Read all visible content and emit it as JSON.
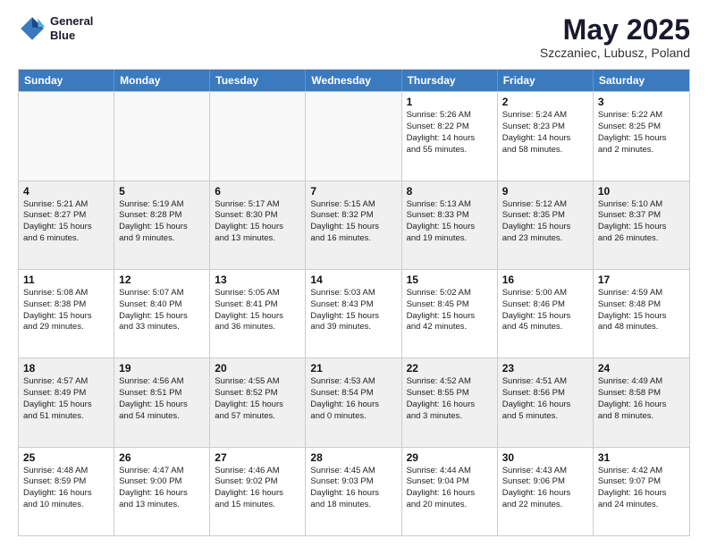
{
  "header": {
    "logo_line1": "General",
    "logo_line2": "Blue",
    "title": "May 2025",
    "subtitle": "Szczaniec, Lubusz, Poland"
  },
  "calendar": {
    "days_of_week": [
      "Sunday",
      "Monday",
      "Tuesday",
      "Wednesday",
      "Thursday",
      "Friday",
      "Saturday"
    ],
    "rows": [
      [
        {
          "day": "",
          "info": "",
          "empty": true
        },
        {
          "day": "",
          "info": "",
          "empty": true
        },
        {
          "day": "",
          "info": "",
          "empty": true
        },
        {
          "day": "",
          "info": "",
          "empty": true
        },
        {
          "day": "1",
          "info": "Sunrise: 5:26 AM\nSunset: 8:22 PM\nDaylight: 14 hours\nand 55 minutes."
        },
        {
          "day": "2",
          "info": "Sunrise: 5:24 AM\nSunset: 8:23 PM\nDaylight: 14 hours\nand 58 minutes."
        },
        {
          "day": "3",
          "info": "Sunrise: 5:22 AM\nSunset: 8:25 PM\nDaylight: 15 hours\nand 2 minutes."
        }
      ],
      [
        {
          "day": "4",
          "info": "Sunrise: 5:21 AM\nSunset: 8:27 PM\nDaylight: 15 hours\nand 6 minutes."
        },
        {
          "day": "5",
          "info": "Sunrise: 5:19 AM\nSunset: 8:28 PM\nDaylight: 15 hours\nand 9 minutes."
        },
        {
          "day": "6",
          "info": "Sunrise: 5:17 AM\nSunset: 8:30 PM\nDaylight: 15 hours\nand 13 minutes."
        },
        {
          "day": "7",
          "info": "Sunrise: 5:15 AM\nSunset: 8:32 PM\nDaylight: 15 hours\nand 16 minutes."
        },
        {
          "day": "8",
          "info": "Sunrise: 5:13 AM\nSunset: 8:33 PM\nDaylight: 15 hours\nand 19 minutes."
        },
        {
          "day": "9",
          "info": "Sunrise: 5:12 AM\nSunset: 8:35 PM\nDaylight: 15 hours\nand 23 minutes."
        },
        {
          "day": "10",
          "info": "Sunrise: 5:10 AM\nSunset: 8:37 PM\nDaylight: 15 hours\nand 26 minutes."
        }
      ],
      [
        {
          "day": "11",
          "info": "Sunrise: 5:08 AM\nSunset: 8:38 PM\nDaylight: 15 hours\nand 29 minutes."
        },
        {
          "day": "12",
          "info": "Sunrise: 5:07 AM\nSunset: 8:40 PM\nDaylight: 15 hours\nand 33 minutes."
        },
        {
          "day": "13",
          "info": "Sunrise: 5:05 AM\nSunset: 8:41 PM\nDaylight: 15 hours\nand 36 minutes."
        },
        {
          "day": "14",
          "info": "Sunrise: 5:03 AM\nSunset: 8:43 PM\nDaylight: 15 hours\nand 39 minutes."
        },
        {
          "day": "15",
          "info": "Sunrise: 5:02 AM\nSunset: 8:45 PM\nDaylight: 15 hours\nand 42 minutes."
        },
        {
          "day": "16",
          "info": "Sunrise: 5:00 AM\nSunset: 8:46 PM\nDaylight: 15 hours\nand 45 minutes."
        },
        {
          "day": "17",
          "info": "Sunrise: 4:59 AM\nSunset: 8:48 PM\nDaylight: 15 hours\nand 48 minutes."
        }
      ],
      [
        {
          "day": "18",
          "info": "Sunrise: 4:57 AM\nSunset: 8:49 PM\nDaylight: 15 hours\nand 51 minutes."
        },
        {
          "day": "19",
          "info": "Sunrise: 4:56 AM\nSunset: 8:51 PM\nDaylight: 15 hours\nand 54 minutes."
        },
        {
          "day": "20",
          "info": "Sunrise: 4:55 AM\nSunset: 8:52 PM\nDaylight: 15 hours\nand 57 minutes."
        },
        {
          "day": "21",
          "info": "Sunrise: 4:53 AM\nSunset: 8:54 PM\nDaylight: 16 hours\nand 0 minutes."
        },
        {
          "day": "22",
          "info": "Sunrise: 4:52 AM\nSunset: 8:55 PM\nDaylight: 16 hours\nand 3 minutes."
        },
        {
          "day": "23",
          "info": "Sunrise: 4:51 AM\nSunset: 8:56 PM\nDaylight: 16 hours\nand 5 minutes."
        },
        {
          "day": "24",
          "info": "Sunrise: 4:49 AM\nSunset: 8:58 PM\nDaylight: 16 hours\nand 8 minutes."
        }
      ],
      [
        {
          "day": "25",
          "info": "Sunrise: 4:48 AM\nSunset: 8:59 PM\nDaylight: 16 hours\nand 10 minutes."
        },
        {
          "day": "26",
          "info": "Sunrise: 4:47 AM\nSunset: 9:00 PM\nDaylight: 16 hours\nand 13 minutes."
        },
        {
          "day": "27",
          "info": "Sunrise: 4:46 AM\nSunset: 9:02 PM\nDaylight: 16 hours\nand 15 minutes."
        },
        {
          "day": "28",
          "info": "Sunrise: 4:45 AM\nSunset: 9:03 PM\nDaylight: 16 hours\nand 18 minutes."
        },
        {
          "day": "29",
          "info": "Sunrise: 4:44 AM\nSunset: 9:04 PM\nDaylight: 16 hours\nand 20 minutes."
        },
        {
          "day": "30",
          "info": "Sunrise: 4:43 AM\nSunset: 9:06 PM\nDaylight: 16 hours\nand 22 minutes."
        },
        {
          "day": "31",
          "info": "Sunrise: 4:42 AM\nSunset: 9:07 PM\nDaylight: 16 hours\nand 24 minutes."
        }
      ]
    ]
  }
}
